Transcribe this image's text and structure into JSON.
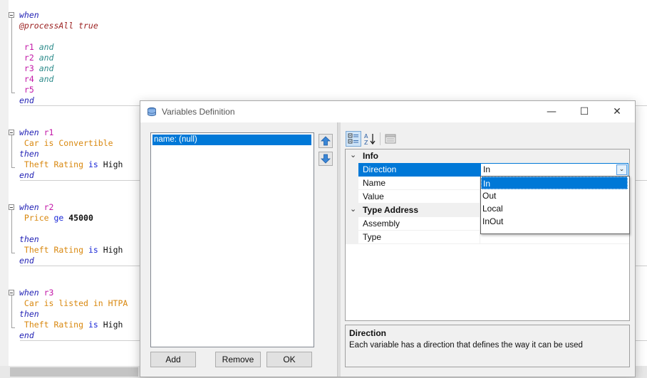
{
  "editor": {
    "blocks": [
      {
        "lines": [
          [
            {
              "t": "when",
              "c": "kw"
            }
          ],
          [
            {
              "t": "@processAll true",
              "c": "maroon"
            }
          ],
          [],
          [
            {
              "t": " r1 ",
              "c": "pink"
            },
            {
              "t": "and",
              "c": "teal"
            }
          ],
          [
            {
              "t": " r2 ",
              "c": "pink"
            },
            {
              "t": "and",
              "c": "teal"
            }
          ],
          [
            {
              "t": " r3 ",
              "c": "pink"
            },
            {
              "t": "and",
              "c": "teal"
            }
          ],
          [
            {
              "t": " r4 ",
              "c": "pink"
            },
            {
              "t": "and",
              "c": "teal"
            }
          ],
          [
            {
              "t": " r5",
              "c": "pink"
            }
          ],
          [
            {
              "t": "end",
              "c": "kw"
            }
          ]
        ]
      },
      {
        "lines": [
          [
            {
              "t": "when ",
              "c": "kw"
            },
            {
              "t": "r1",
              "c": "pink"
            }
          ],
          [
            {
              "t": " Car is Convertible",
              "c": "orange"
            }
          ],
          [
            {
              "t": "then",
              "c": "kw"
            }
          ],
          [
            {
              "t": " Theft Rating ",
              "c": "orange"
            },
            {
              "t": "is ",
              "c": "blue"
            },
            {
              "t": "High",
              "c": "black"
            }
          ],
          [
            {
              "t": "end",
              "c": "kw"
            }
          ]
        ]
      },
      {
        "lines": [
          [
            {
              "t": "when ",
              "c": "kw"
            },
            {
              "t": "r2",
              "c": "pink"
            }
          ],
          [
            {
              "t": " Price ",
              "c": "orange"
            },
            {
              "t": "ge ",
              "c": "blue"
            },
            {
              "t": "45000",
              "c": "black bold"
            }
          ],
          [],
          [
            {
              "t": "then",
              "c": "kw"
            }
          ],
          [
            {
              "t": " Theft Rating ",
              "c": "orange"
            },
            {
              "t": "is ",
              "c": "blue"
            },
            {
              "t": "High",
              "c": "black"
            }
          ],
          [
            {
              "t": "end",
              "c": "kw"
            }
          ]
        ]
      },
      {
        "lines": [
          [
            {
              "t": "when ",
              "c": "kw"
            },
            {
              "t": "r3",
              "c": "pink"
            }
          ],
          [
            {
              "t": " Car is listed in HTPA",
              "c": "orange"
            }
          ],
          [
            {
              "t": "then",
              "c": "kw"
            }
          ],
          [
            {
              "t": " Theft Rating ",
              "c": "orange"
            },
            {
              "t": "is ",
              "c": "blue"
            },
            {
              "t": "High",
              "c": "black"
            }
          ],
          [
            {
              "t": "end",
              "c": "kw"
            }
          ]
        ]
      }
    ]
  },
  "dialog": {
    "title": "Variables Definition",
    "window_buttons": {
      "minimize": "—",
      "maximize": "☐",
      "close": "✕"
    },
    "list": {
      "items": [
        "name: (null)"
      ]
    },
    "buttons": {
      "add": "Add",
      "remove": "Remove",
      "ok": "OK"
    },
    "toolbar": {
      "categorized_icon": "categorized-icon",
      "alphabetical_icon": "sort-az-icon",
      "pages_icon": "property-pages-icon"
    },
    "grid": {
      "categories": [
        {
          "name": "Info",
          "toggle": "⌄",
          "props": [
            {
              "name": "Direction",
              "value": "In"
            },
            {
              "name": "Name",
              "value": ""
            },
            {
              "name": "Value",
              "value": ""
            }
          ]
        },
        {
          "name": "Type Address",
          "toggle": "⌄",
          "props": [
            {
              "name": "Assembly",
              "value": ""
            },
            {
              "name": "Type",
              "value": ""
            }
          ]
        }
      ]
    },
    "dropdown": {
      "options": [
        "In",
        "Out",
        "Local",
        "InOut"
      ],
      "selected": "In",
      "arrow": "⌄"
    },
    "help": {
      "title": "Direction",
      "description": "Each variable has a direction that defines the way it can be used"
    }
  }
}
